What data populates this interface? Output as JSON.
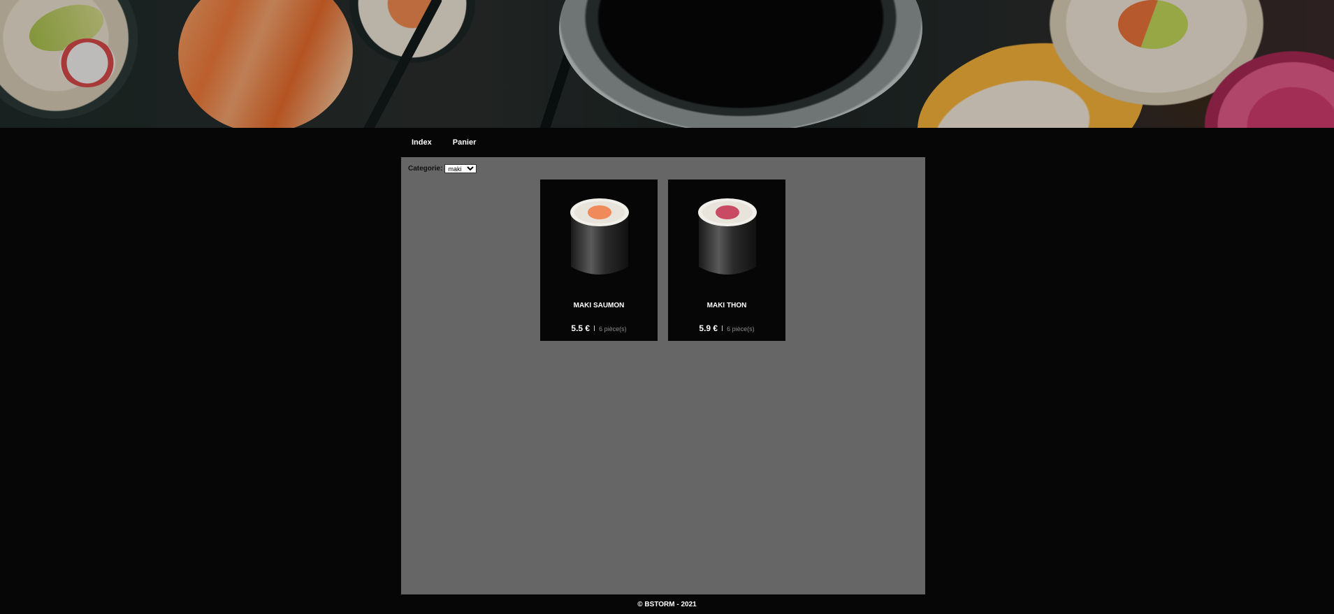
{
  "nav": {
    "items": [
      {
        "label": "Index"
      },
      {
        "label": "Panier"
      }
    ]
  },
  "filter": {
    "label": "Categorie:",
    "selected": "maki"
  },
  "products": [
    {
      "name": "MAKI SAUMON",
      "price": "5.5 €",
      "pieces": "6 pièce(s)",
      "fish_color": "#f08a5a"
    },
    {
      "name": "MAKI THON",
      "price": "5.9 €",
      "pieces": "6 pièce(s)",
      "fish_color": "#c94a63"
    }
  ],
  "footer": {
    "text": "© BSTORM - 2021"
  },
  "colors": {
    "page_bg": "#060606",
    "panel_bg": "#666666",
    "card_bg": "#060606"
  }
}
